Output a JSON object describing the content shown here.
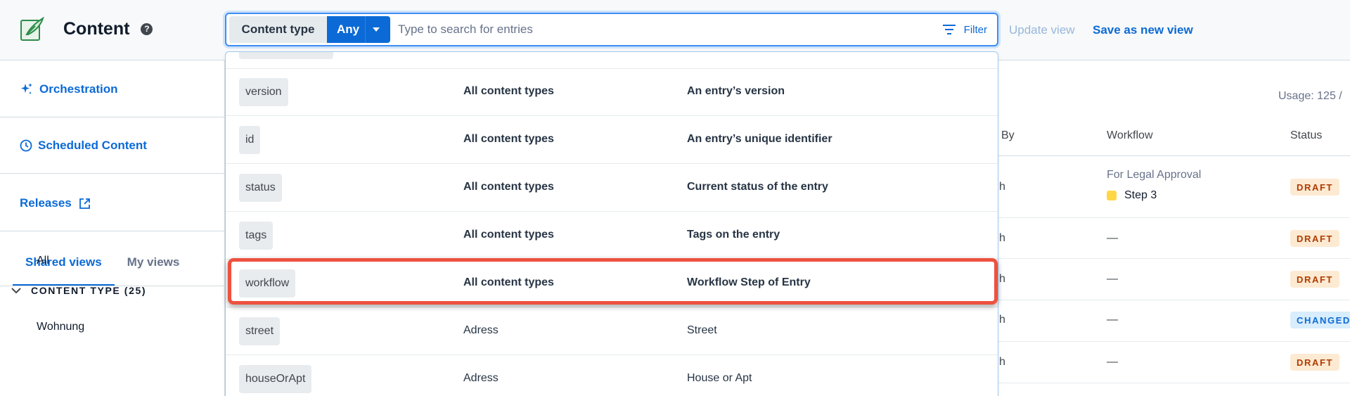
{
  "header": {
    "title": "Content",
    "help_icon": "help-circle-icon",
    "search": {
      "content_type_label": "Content type",
      "content_type_value": "Any",
      "placeholder": "Type to search for entries",
      "filter_label": "Filter"
    },
    "update_view": "Update view",
    "save_view": "Save as new view"
  },
  "sidebar": {
    "orchestration": "Orchestration",
    "scheduled": "Scheduled Content",
    "releases": "Releases",
    "tabs": {
      "shared": "Shared views",
      "mine": "My views"
    },
    "all": "All",
    "content_type_group": "CONTENT TYPE (25)",
    "first_type": "Wohnung"
  },
  "table": {
    "usage": "Usage: 125 /",
    "headers": {
      "by": "By",
      "workflow": "Workflow",
      "status": "Status"
    },
    "rows": [
      {
        "by": "h",
        "workflow_title": "For Legal Approval",
        "workflow_step": "Step 3",
        "status": "DRAFT"
      },
      {
        "by": "h",
        "workflow": "—",
        "status": "DRAFT"
      },
      {
        "by": "h",
        "workflow": "—",
        "status": "DRAFT"
      },
      {
        "by": "h",
        "workflow": "—",
        "status": "CHANGED"
      },
      {
        "by": "h",
        "workflow": "—",
        "status": "DRAFT"
      }
    ]
  },
  "dropdown": {
    "rows": [
      {
        "key": "version",
        "scope": "All content types",
        "description": "An entry’s version",
        "bold": true
      },
      {
        "key": "id",
        "scope": "All content types",
        "description": "An entry’s unique identifier",
        "bold": true
      },
      {
        "key": "status",
        "scope": "All content types",
        "description": "Current status of the entry",
        "bold": true
      },
      {
        "key": "tags",
        "scope": "All content types",
        "description": "Tags on the entry",
        "bold": true
      },
      {
        "key": "workflow",
        "scope": "All content types",
        "description": "Workflow Step of Entry",
        "bold": true
      },
      {
        "key": "street",
        "scope": "Adress",
        "description": "Street",
        "bold": false
      },
      {
        "key": "houseOrApt",
        "scope": "Adress",
        "description": "House or Apt",
        "bold": false
      }
    ]
  },
  "colors": {
    "accent": "#0b6ad6",
    "highlight": "#ee5140",
    "draft": "#b03a00",
    "changed": "#0b6ad6"
  }
}
